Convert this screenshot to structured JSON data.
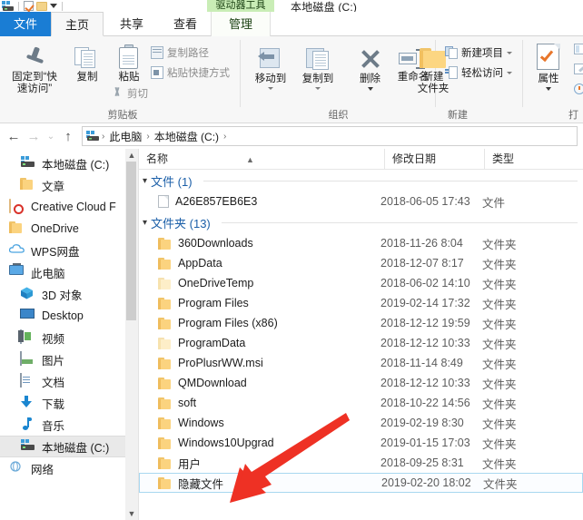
{
  "window": {
    "document_title": "本地磁盘 (C:)",
    "contextual_tab_header": "驱动器工具"
  },
  "quick_access_toolbar": [
    {
      "name": "drive-icon",
      "label": "本地磁盘 (C:)"
    },
    {
      "name": "properties-icon",
      "label": "属性"
    },
    {
      "name": "new-folder-icon",
      "label": "新建文件夹"
    },
    {
      "name": "customize-caret-icon",
      "label": "自定义快速访问工具栏"
    }
  ],
  "tabs": [
    {
      "id": "file",
      "label": "文件"
    },
    {
      "id": "home",
      "label": "主页"
    },
    {
      "id": "share",
      "label": "共享"
    },
    {
      "id": "view",
      "label": "查看"
    },
    {
      "id": "manage",
      "label": "管理"
    }
  ],
  "ribbon": {
    "groups": [
      {
        "id": "clipboard",
        "label": "剪贴板",
        "big_buttons": [
          {
            "id": "pin-to-quick-access",
            "label_line1": "固定到“快",
            "label_line2": "速访问”"
          },
          {
            "id": "copy",
            "label_line1": "复制",
            "label_line2": ""
          },
          {
            "id": "paste",
            "label_line1": "粘贴",
            "label_line2": ""
          }
        ],
        "small_buttons": [
          {
            "id": "copy-path",
            "label": "复制路径"
          },
          {
            "id": "paste-shortcut",
            "label": "粘贴快捷方式"
          },
          {
            "id": "cut",
            "label": "剪切"
          }
        ]
      },
      {
        "id": "organize",
        "label": "组织",
        "big_buttons": [
          {
            "id": "move-to",
            "label_line1": "移动到",
            "label_line2": ""
          },
          {
            "id": "copy-to",
            "label_line1": "复制到",
            "label_line2": ""
          },
          {
            "id": "delete",
            "label_line1": "删除",
            "label_line2": ""
          },
          {
            "id": "rename",
            "label_line1": "重命名",
            "label_line2": ""
          }
        ]
      },
      {
        "id": "new",
        "label": "新建",
        "big_buttons": [
          {
            "id": "new-folder",
            "label_line1": "新建",
            "label_line2": "文件夹"
          }
        ],
        "small_buttons": [
          {
            "id": "new-item",
            "label": "新建项目"
          },
          {
            "id": "easy-access",
            "label": "轻松访问"
          }
        ]
      },
      {
        "id": "open",
        "label": "打",
        "big_buttons": [
          {
            "id": "properties",
            "label_line1": "属性",
            "label_line2": ""
          }
        ]
      }
    ]
  },
  "address_bar": {
    "back": "←",
    "forward": "→",
    "recent": "⌄",
    "up": "↑",
    "crumbs": [
      "此电脑",
      "本地磁盘 (C:)"
    ],
    "separator": "›"
  },
  "navigation_pane": {
    "items": [
      {
        "label": "本地磁盘 (C:)",
        "icon": "drive-icon",
        "indent": 1,
        "selected": false
      },
      {
        "label": "文章",
        "icon": "folder-icon",
        "indent": 1,
        "selected": false
      },
      {
        "label": "Creative Cloud F",
        "icon": "creative-cloud-icon",
        "indent": 0,
        "selected": false
      },
      {
        "label": "OneDrive",
        "icon": "folder-icon",
        "indent": 0,
        "selected": false
      },
      {
        "label": "WPS网盘",
        "icon": "cloud-icon",
        "indent": 0,
        "selected": false
      },
      {
        "label": "此电脑",
        "icon": "pc-icon",
        "indent": 0,
        "selected": false
      },
      {
        "label": "3D 对象",
        "icon": "3d-object-icon",
        "indent": 1,
        "selected": false
      },
      {
        "label": "Desktop",
        "icon": "desktop-icon",
        "indent": 1,
        "selected": false
      },
      {
        "label": "视频",
        "icon": "video-icon",
        "indent": 1,
        "selected": false
      },
      {
        "label": "图片",
        "icon": "pictures-icon",
        "indent": 1,
        "selected": false
      },
      {
        "label": "文档",
        "icon": "documents-icon",
        "indent": 1,
        "selected": false
      },
      {
        "label": "下载",
        "icon": "downloads-icon",
        "indent": 1,
        "selected": false
      },
      {
        "label": "音乐",
        "icon": "music-icon",
        "indent": 1,
        "selected": false
      },
      {
        "label": "本地磁盘 (C:)",
        "icon": "drive-icon",
        "indent": 1,
        "selected": true
      },
      {
        "label": "网络",
        "icon": "network-icon",
        "indent": 0,
        "selected": false
      }
    ]
  },
  "file_list": {
    "columns": [
      {
        "id": "name",
        "label": "名称",
        "sorted": true
      },
      {
        "id": "date",
        "label": "修改日期",
        "sorted": false
      },
      {
        "id": "type",
        "label": "类型",
        "sorted": false
      }
    ],
    "groups": [
      {
        "id": "files",
        "label": "文件 (1)",
        "rows": [
          {
            "name": "A26E857EB6E3",
            "date": "2018-06-05 17:43",
            "type": "文件",
            "icon": "file-icon",
            "hidden": false,
            "selected": false
          }
        ]
      },
      {
        "id": "folders",
        "label": "文件夹 (13)",
        "rows": [
          {
            "name": "360Downloads",
            "date": "2018-11-26 8:04",
            "type": "文件夹",
            "icon": "folder-icon",
            "hidden": false,
            "selected": false
          },
          {
            "name": "AppData",
            "date": "2018-12-07 8:17",
            "type": "文件夹",
            "icon": "folder-icon",
            "hidden": false,
            "selected": false
          },
          {
            "name": "OneDriveTemp",
            "date": "2018-06-02 14:10",
            "type": "文件夹",
            "icon": "folder-icon",
            "hidden": true,
            "selected": false
          },
          {
            "name": "Program Files",
            "date": "2019-02-14 17:32",
            "type": "文件夹",
            "icon": "folder-icon",
            "hidden": false,
            "selected": false
          },
          {
            "name": "Program Files (x86)",
            "date": "2018-12-12 19:59",
            "type": "文件夹",
            "icon": "folder-icon",
            "hidden": false,
            "selected": false
          },
          {
            "name": "ProgramData",
            "date": "2018-12-12 10:33",
            "type": "文件夹",
            "icon": "folder-icon",
            "hidden": true,
            "selected": false
          },
          {
            "name": "ProPlusrWW.msi",
            "date": "2018-11-14 8:49",
            "type": "文件夹",
            "icon": "folder-icon",
            "hidden": false,
            "selected": false
          },
          {
            "name": "QMDownload",
            "date": "2018-12-12 10:33",
            "type": "文件夹",
            "icon": "folder-icon",
            "hidden": false,
            "selected": false
          },
          {
            "name": "soft",
            "date": "2018-10-22 14:56",
            "type": "文件夹",
            "icon": "folder-icon",
            "hidden": false,
            "selected": false
          },
          {
            "name": "Windows",
            "date": "2019-02-19 8:30",
            "type": "文件夹",
            "icon": "folder-icon",
            "hidden": false,
            "selected": false
          },
          {
            "name": "Windows10Upgrad",
            "date": "2019-01-15 17:03",
            "type": "文件夹",
            "icon": "folder-icon",
            "hidden": false,
            "selected": false
          },
          {
            "name": "用户",
            "date": "2018-09-25 8:31",
            "type": "文件夹",
            "icon": "folder-icon",
            "hidden": false,
            "selected": false
          },
          {
            "name": "隐藏文件",
            "date": "2019-02-20 18:02",
            "type": "文件夹",
            "icon": "folder-icon",
            "hidden": false,
            "selected": true
          }
        ]
      }
    ]
  },
  "annotation": {
    "type": "red-arrow",
    "color": "#ee3124",
    "points_to": "隐藏文件"
  },
  "colors": {
    "tab_active_blue": "#1a7dd4",
    "contextual_green": "#c9edb6",
    "group_header_blue": "#1b5fa8",
    "selection_border": "#a8d8f0",
    "folder_yellow": "#fbd37f"
  }
}
